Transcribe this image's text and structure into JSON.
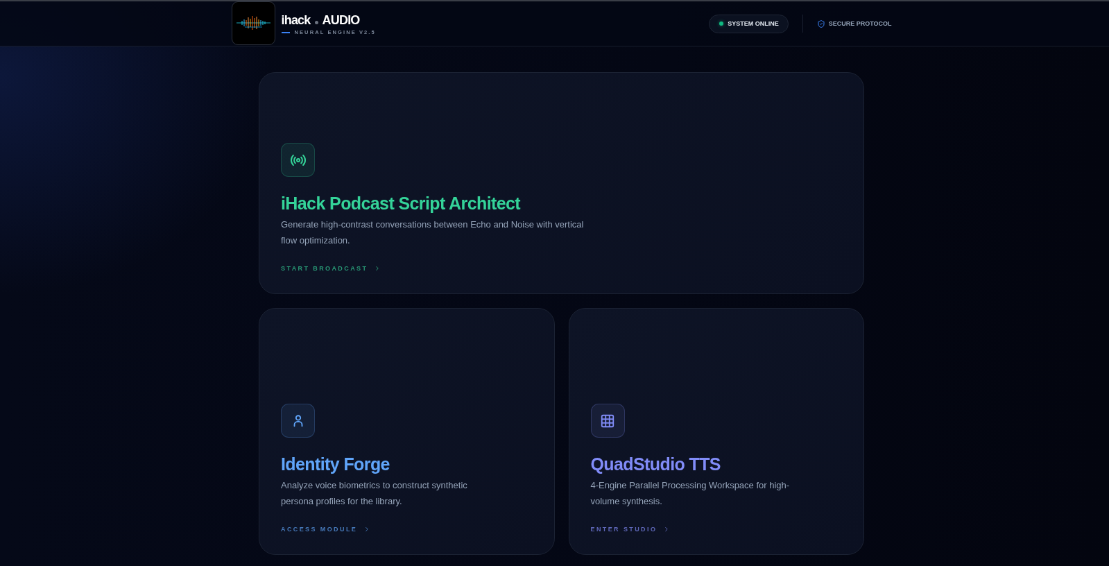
{
  "header": {
    "brand": {
      "name": "ihack",
      "product": "AUDIO",
      "tagline": "NEURAL ENGINE V2.5"
    },
    "status": {
      "label": "SYSTEM ONLINE",
      "online": true
    },
    "security": {
      "label": "SECURE PROTOCOL"
    }
  },
  "cards": [
    {
      "kind": "broadcast",
      "featured": true,
      "color": "#34d399",
      "title": "iHack Podcast Script Architect",
      "description": "Generate high-contrast conversations between Echo and Noise with vertical flow optimization.",
      "action": "START BROADCAST"
    },
    {
      "kind": "persona",
      "featured": false,
      "color": "#60a5fa",
      "title": "Identity Forge",
      "description": "Analyze voice biometrics to construct synthetic persona profiles for the library.",
      "action": "ACCESS MODULE"
    },
    {
      "kind": "grid",
      "featured": false,
      "color": "#818cf8",
      "title": "QuadStudio TTS",
      "description": "4-Engine Parallel Processing Workspace for high-volume synthesis.",
      "action": "ENTER STUDIO"
    }
  ]
}
